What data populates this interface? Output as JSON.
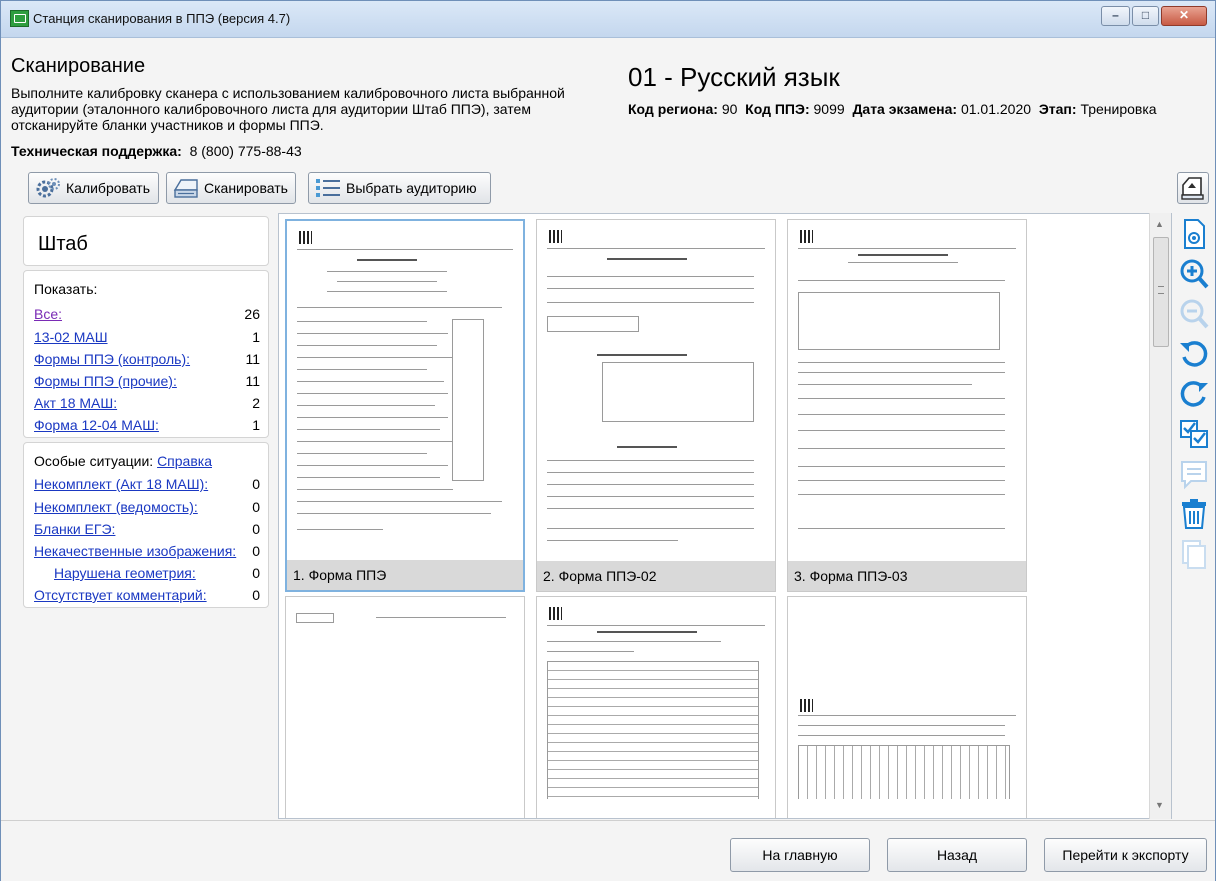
{
  "window": {
    "title": "Станция сканирования в ППЭ (версия 4.7)"
  },
  "header": {
    "title": "Сканирование",
    "description": "Выполните калибровку сканера с использованием калибровочного листа выбранной аудитории (эталонного калибровочного листа для аудитории Штаб ППЭ), затем отсканируйте бланки участников и формы ППЭ.",
    "support_label": "Техническая поддержка:",
    "support_phone": "8 (800) 775-88-43",
    "subject": "01 - Русский язык",
    "region_label": "Код региона:",
    "region": "90",
    "ppe_label": "Код ППЭ:",
    "ppe": "9099",
    "date_label": "Дата экзамена:",
    "date": "01.01.2020",
    "stage_label": "Этап:",
    "stage": "Тренировка"
  },
  "toolbar": {
    "calibrate": "Калибровать",
    "scan": "Сканировать",
    "select_room": "Выбрать аудиторию"
  },
  "left": {
    "room_name": "Штаб",
    "show_label": "Показать:",
    "show_items": [
      {
        "label": "Все:",
        "count": "26"
      },
      {
        "label": "13-02 МАШ",
        "count": "1"
      },
      {
        "label": "Формы ППЭ (контроль):",
        "count": "11"
      },
      {
        "label": "Формы ППЭ (прочие):",
        "count": "11"
      },
      {
        "label": "Акт 18 МАШ:",
        "count": "2"
      },
      {
        "label": "Форма 12-04 МАШ:",
        "count": "1"
      }
    ],
    "special_label": "Особые ситуации:",
    "special_help": "Справка",
    "special_items": [
      {
        "label": "Некомплект (Акт 18 МАШ):",
        "count": "0"
      },
      {
        "label": "Некомплект (ведомость):",
        "count": "0"
      },
      {
        "label": "Бланки ЕГЭ:",
        "count": "0"
      },
      {
        "label": "Некачественные изображения:",
        "count": "0"
      },
      {
        "label": "Нарушена геометрия:",
        "count": "0"
      },
      {
        "label": "Отсутствует комментарий:",
        "count": "0"
      }
    ]
  },
  "gallery": {
    "tiles": [
      {
        "caption": "1. Форма ППЭ"
      },
      {
        "caption": "2. Форма ППЭ-02"
      },
      {
        "caption": "3. Форма ППЭ-03"
      }
    ]
  },
  "footer": {
    "main": "На главную",
    "back": "Назад",
    "export": "Перейти к экспорту"
  },
  "icons": [
    "calibrate-icon",
    "scanner-icon",
    "list-icon",
    "eject-icon",
    "view-page-icon",
    "zoom-in-icon",
    "zoom-out-icon",
    "rotate-left-icon",
    "rotate-right-icon",
    "checklist-icon",
    "comment-icon",
    "delete-icon",
    "copy-icon"
  ],
  "colors": {
    "accent": "#1a7fd0",
    "link": "#1a38c2",
    "selection": "#7fb2df"
  }
}
